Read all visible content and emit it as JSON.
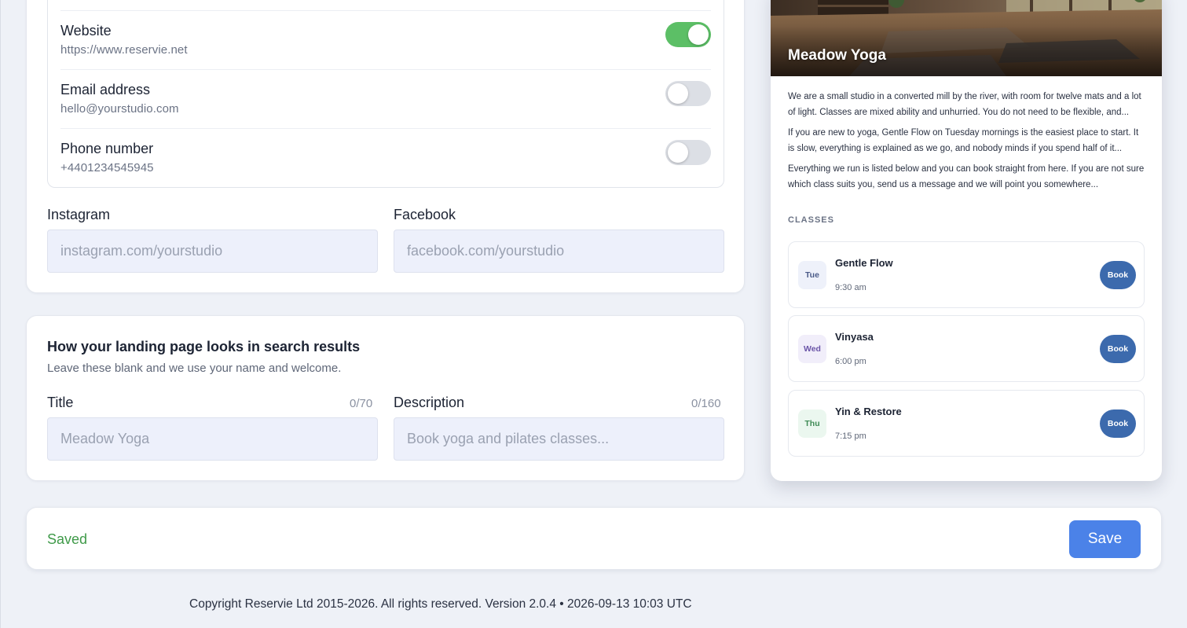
{
  "contact": {
    "rows": [
      {
        "label": "Website",
        "value": "https://www.reservie.net",
        "enabled": true
      },
      {
        "label": "Email address",
        "value": "hello@yourstudio.com",
        "enabled": false
      },
      {
        "label": "Phone number",
        "value": "+4401234545945",
        "enabled": false
      }
    ],
    "instagram": {
      "label": "Instagram",
      "placeholder": "instagram.com/yourstudio",
      "value": ""
    },
    "facebook": {
      "label": "Facebook",
      "placeholder": "facebook.com/yourstudio",
      "value": ""
    }
  },
  "seo": {
    "heading": "How your landing page looks in search results",
    "subheading": "Leave these blank and we use your name and welcome.",
    "title": {
      "label": "Title",
      "counter": "0/70",
      "placeholder": "Meadow Yoga",
      "value": ""
    },
    "description": {
      "label": "Description",
      "counter": "0/160",
      "placeholder": "Book yoga and pilates classes...",
      "value": ""
    }
  },
  "save_bar": {
    "status": "Saved",
    "save_label": "Save"
  },
  "footer": {
    "text": "Copyright Reservie Ltd 2015-2026. All rights reserved. Version 2.0.4 • 2026-09-13 10:03 UTC"
  },
  "preview": {
    "studio_name": "Meadow Yoga",
    "paragraphs": [
      "We are a small studio in a converted mill by the river, with room for twelve mats and a lot of light. Classes are mixed ability and unhurried. You do not need to be flexible, and...",
      "If you are new to yoga, Gentle Flow on Tuesday mornings is the easiest place to start. It is slow, everything is explained as we go, and nobody minds if you spend half of it...",
      "Everything we run is listed below and you can book straight from here. If you are not sure which class suits you, send us a message and we will point you somewhere..."
    ],
    "classes_heading": "CLASSES",
    "classes": [
      {
        "day": "Tue",
        "name": "Gentle Flow",
        "time": "9:30 am",
        "book_label": "Book",
        "badge_bg": "#eef1fa",
        "badge_fg": "#4a5a88"
      },
      {
        "day": "Wed",
        "name": "Vinyasa",
        "time": "6:00 pm",
        "book_label": "Book",
        "badge_bg": "#f1eefa",
        "badge_fg": "#6b55a8"
      },
      {
        "day": "Thu",
        "name": "Yin & Restore",
        "time": "7:15 pm",
        "book_label": "Book",
        "badge_bg": "#ebf7ef",
        "badge_fg": "#3e8a55"
      }
    ]
  },
  "colors": {
    "accent": "#4b82e8",
    "toggle_on": "#5cbf66",
    "saved_text": "#3f9a49",
    "book_button": "#3c6aad"
  }
}
